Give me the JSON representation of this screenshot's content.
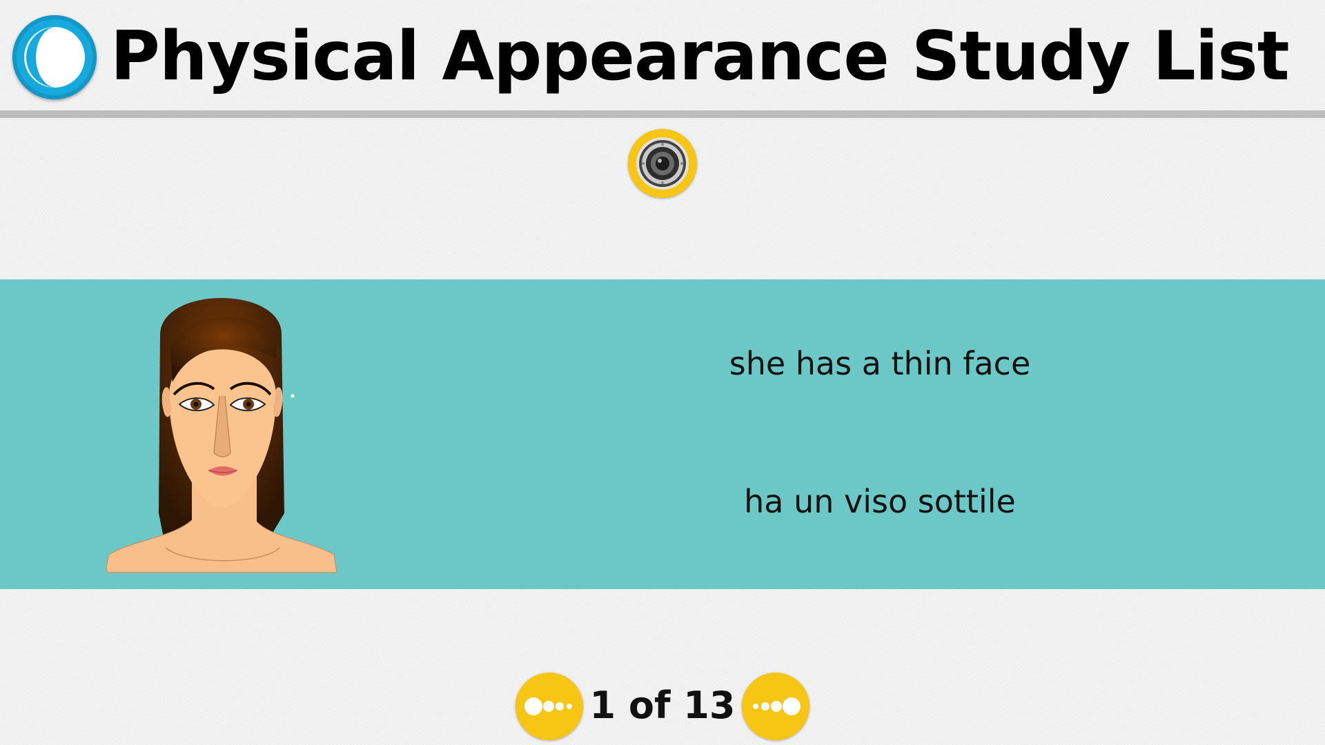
{
  "header": {
    "title": "Physical Appearance Study List",
    "back_icon": "half-moon-back-icon"
  },
  "audio": {
    "icon": "speaker-icon"
  },
  "card": {
    "image_icon": "woman-thin-face-portrait",
    "english_phrase": "she has a thin face",
    "italian_phrase": "ha un viso sottile"
  },
  "pagination": {
    "current": 1,
    "total": 13,
    "label": "1 of 13",
    "prev_icon": "dots-previous-icon",
    "next_icon": "dots-next-icon"
  },
  "colors": {
    "background": "#f3f3f3",
    "header_rule": "#bdbdbd",
    "back_button": "#15a9dd",
    "card_band": "#6bc8c6",
    "accent_yellow": "#f7c514",
    "text": "#111111"
  }
}
